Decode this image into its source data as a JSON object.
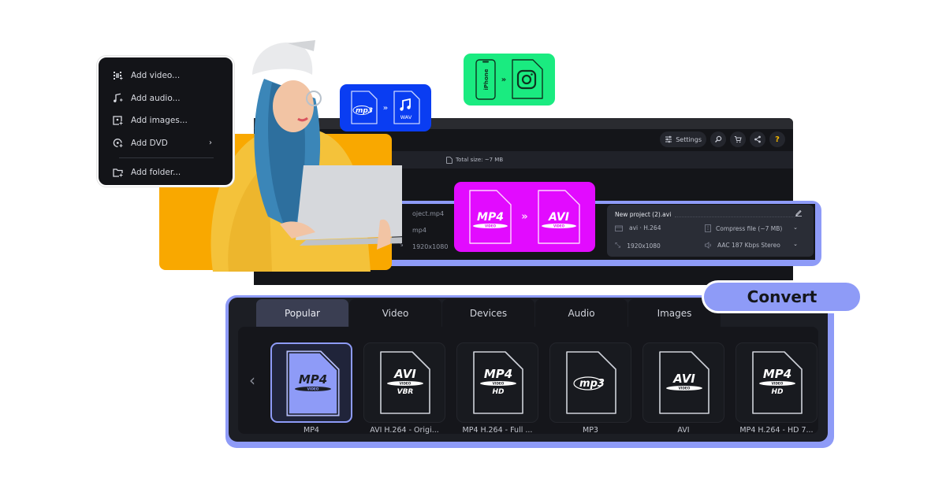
{
  "add_menu": {
    "items": [
      {
        "label": "Add video...",
        "icon": "add-video-icon"
      },
      {
        "label": "Add audio...",
        "icon": "add-audio-icon"
      },
      {
        "label": "Add images...",
        "icon": "add-images-icon"
      },
      {
        "label": "Add DVD",
        "icon": "add-dvd-icon",
        "has_submenu": true
      },
      {
        "label": "Add folder...",
        "icon": "add-folder-icon"
      }
    ],
    "submenu_glyph": "›"
  },
  "badges": {
    "blue": {
      "from": "mp3",
      "to": "WAV",
      "arrow": "»",
      "color": "#0a3df2"
    },
    "green": {
      "from": "iPhone",
      "to": "instagram-icon",
      "arrow": "»",
      "color": "#1aeb80"
    },
    "magenta": {
      "from": "MP4",
      "from_sub": "VIDEO",
      "to": "AVI",
      "to_sub": "VIDEO",
      "arrow": "»",
      "color": "#e20bff"
    }
  },
  "toolbar": {
    "settings_label": "Settings",
    "search_icon": "search-icon",
    "cart_icon": "cart-icon",
    "share_icon": "share-icon",
    "help_glyph": "?"
  },
  "infobar": {
    "total_size": "Total size: ~7 MB"
  },
  "source_file": {
    "name_partial": "oject.mp4",
    "format_partial": "mp4",
    "resolution": "1920x1080"
  },
  "output_file": {
    "name": "New project (2).avi",
    "codec": "avi · H.264",
    "resolution": "1920x1080",
    "compress_label": "Compress file (~7 MB)",
    "audio_label": "AAC 187 Kbps Stereo"
  },
  "format_panel": {
    "tabs": [
      {
        "label": "Popular",
        "active": true
      },
      {
        "label": "Video",
        "active": false
      },
      {
        "label": "Devices",
        "active": false
      },
      {
        "label": "Audio",
        "active": false
      },
      {
        "label": "Images",
        "active": false
      }
    ],
    "prev_glyph": "‹",
    "tiles": [
      {
        "label": "MP4",
        "icon_main": "MP4",
        "icon_sub": "VIDEO",
        "icon_extra": "",
        "selected": true
      },
      {
        "label": "AVI H.264 - Origi...",
        "icon_main": "AVI",
        "icon_sub": "VIDEO",
        "icon_extra": "VBR",
        "selected": false
      },
      {
        "label": "MP4 H.264 - Full ...",
        "icon_main": "MP4",
        "icon_sub": "VIDEO",
        "icon_extra": "HD",
        "selected": false
      },
      {
        "label": "MP3",
        "icon_main": "mp3",
        "icon_sub": "",
        "icon_extra": "",
        "selected": false
      },
      {
        "label": "AVI",
        "icon_main": "AVI",
        "icon_sub": "VIDEO",
        "icon_extra": "",
        "selected": false
      },
      {
        "label": "MP4 H.264 - HD 7...",
        "icon_main": "MP4",
        "icon_sub": "VIDEO",
        "icon_extra": "HD",
        "selected": false
      }
    ]
  },
  "convert_label": "Convert",
  "colors": {
    "accent": "#8e9bf7",
    "orange": "#f9a800",
    "dark_bg": "#141519"
  }
}
